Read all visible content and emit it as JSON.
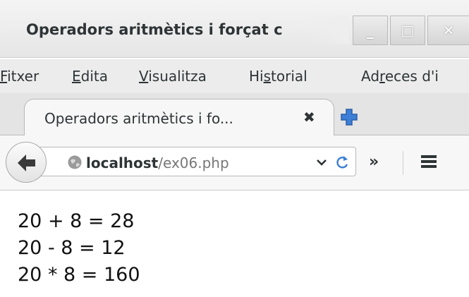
{
  "window": {
    "title": "Operadors aritmètics i forçat c",
    "minimize_label": "_",
    "maximize_label": "□",
    "close_label": "✕"
  },
  "menubar": {
    "items": [
      {
        "pre": "",
        "key": "F",
        "post": "itxer"
      },
      {
        "pre": "",
        "key": "E",
        "post": "dita"
      },
      {
        "pre": "",
        "key": "V",
        "post": "isualitza"
      },
      {
        "pre": "Hi",
        "key": "s",
        "post": "torial"
      },
      {
        "pre": "Ad",
        "key": "r",
        "post": "eces d'i"
      }
    ]
  },
  "tab": {
    "label": "Operadors aritmètics i fo...",
    "close": "✖"
  },
  "navbar": {
    "url_host": "localhost",
    "url_path": "/ex06.php",
    "overflow": "»"
  },
  "content": {
    "lines": [
      "20 + 8 = 28",
      "20 - 8 = 12",
      "20 * 8 = 160"
    ]
  },
  "colors": {
    "newtab_plus": "#3d7fd6",
    "text": "#2e3436"
  }
}
